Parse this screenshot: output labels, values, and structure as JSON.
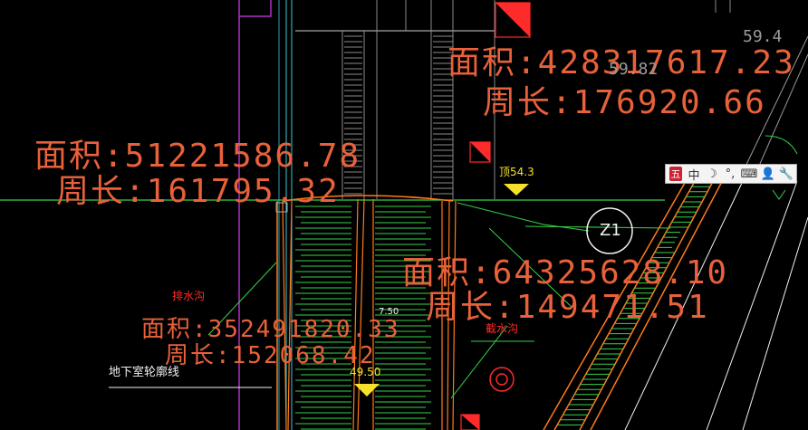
{
  "areas": [
    {
      "area": "面积:428317617.23",
      "perimeter": "周长:176920.66"
    },
    {
      "area": "面积:51221586.78",
      "perimeter": "周长:161795.32"
    },
    {
      "area": "面积:64325628.10",
      "perimeter": "周长:149471.51"
    },
    {
      "area": "面积:352491820.33",
      "perimeter": "周长:152068.42"
    }
  ],
  "labels": {
    "drain_left": "排水沟",
    "drain_right": "截水沟",
    "basement": "地下室轮廓线",
    "elev_top": "顶54.3",
    "elev_bottom": "49.50",
    "dim": "7.50",
    "z1": "Z1",
    "coord_a": "59.82",
    "coord_b": "59.4"
  },
  "ime_toolbar": {
    "logo": "五",
    "mode": "中",
    "moon": "☽",
    "punct": "°,",
    "keyboard": "⌨",
    "user": "👤",
    "tools": "🔧"
  }
}
